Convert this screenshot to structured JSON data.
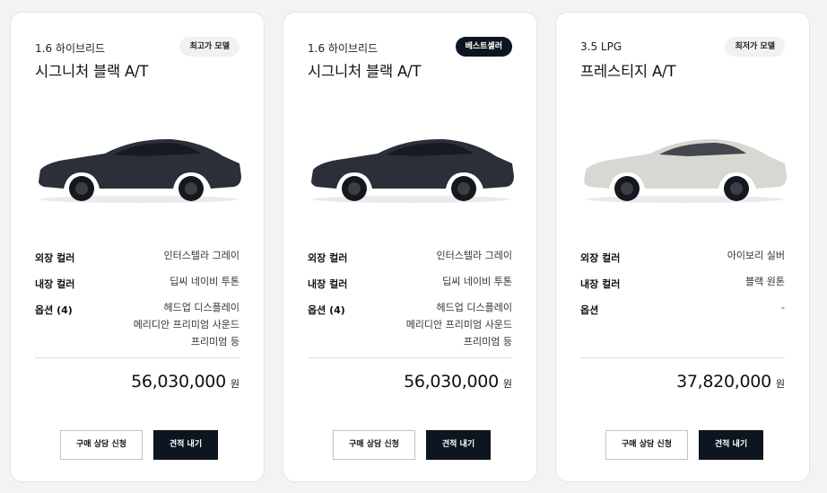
{
  "cards": [
    {
      "engine": "1.6 하이브리드",
      "badge": "최고가 모델",
      "badge_style": "light",
      "model": "시그니처 블랙 A/T",
      "car_color": "#2a2f38",
      "specs": {
        "exterior_label": "외장 컬러",
        "exterior_value": "인터스텔라 그레이",
        "interior_label": "내장 컬러",
        "interior_value": "딥씨 네이비 투톤",
        "options_label": "옵션 (4)",
        "options_values": [
          "헤드업 디스플레이",
          "메리디안 프리미엄 사운드",
          "프리미엄 등"
        ]
      },
      "price": "56,030,000",
      "unit": "원",
      "consult_label": "구매 상담 신청",
      "quote_label": "견적 내기"
    },
    {
      "engine": "1.6 하이브리드",
      "badge": "베스트셀러",
      "badge_style": "dark",
      "model": "시그니처 블랙 A/T",
      "car_color": "#2a2f38",
      "specs": {
        "exterior_label": "외장 컬러",
        "exterior_value": "인터스텔라 그레이",
        "interior_label": "내장 컬러",
        "interior_value": "딥씨 네이비 투톤",
        "options_label": "옵션 (4)",
        "options_values": [
          "헤드업 디스플레이",
          "메리디안 프리미엄 사운드",
          "프리미엄 등"
        ]
      },
      "price": "56,030,000",
      "unit": "원",
      "consult_label": "구매 상담 신청",
      "quote_label": "견적 내기"
    },
    {
      "engine": "3.5 LPG",
      "badge": "최저가 모델",
      "badge_style": "light",
      "model": "프레스티지 A/T",
      "car_color": "#d8d8d3",
      "specs": {
        "exterior_label": "외장 컬러",
        "exterior_value": "아이보리 실버",
        "interior_label": "내장 컬러",
        "interior_value": "블랙 원톤",
        "options_label": "옵션",
        "options_values": [
          "-"
        ]
      },
      "price": "37,820,000",
      "unit": "원",
      "consult_label": "구매 상담 신청",
      "quote_label": "견적 내기"
    }
  ]
}
